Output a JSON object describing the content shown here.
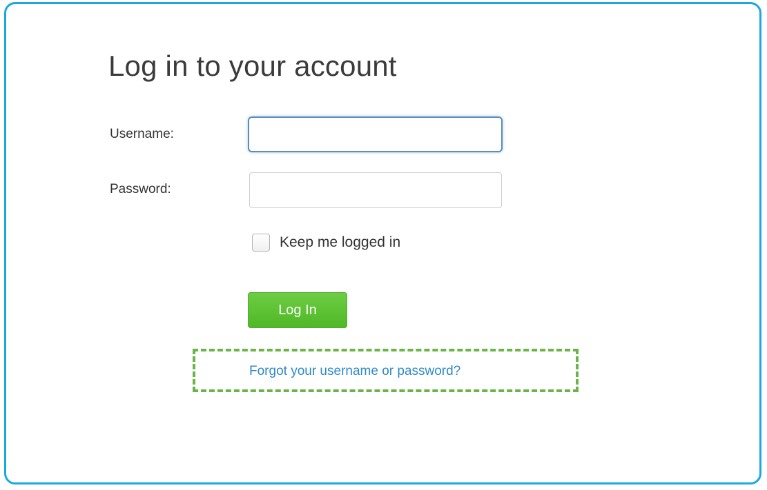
{
  "login": {
    "title": "Log in to your account",
    "username_label": "Username:",
    "username_value": "",
    "password_label": "Password:",
    "password_value": "",
    "keep_logged_in_label": "Keep me logged in",
    "keep_logged_in_checked": false,
    "login_button_label": "Log In",
    "forgot_link_text": "Forgot your username or password?"
  },
  "colors": {
    "frame_border": "#19a9e0",
    "button_green": "#5cc233",
    "link_blue": "#2e8ac6",
    "highlight_dashed": "#6ab547",
    "focused_input_border": "#5b8fb9"
  }
}
